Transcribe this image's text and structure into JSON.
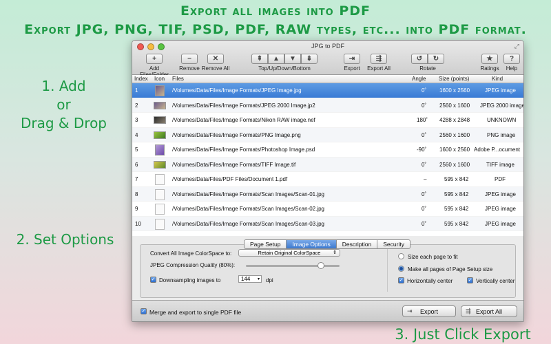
{
  "promo": {
    "headline1": "Export all images into PDF",
    "headline2": "Export JPG, PNG, TIF, PSD, PDF, RAW types, etc... into PDF format.",
    "step1_line1": "1. Add",
    "step1_line2": "or",
    "step1_line3": "Drag & Drop",
    "step2": "2. Set Options",
    "step3": "3. Just Click Export",
    "color": "#1d9a45"
  },
  "window": {
    "title": "JPG to PDF",
    "toolbar": {
      "add": "Add Files/Folder",
      "remove": "Remove",
      "remove_all": "Remove All",
      "move": "Top/Up/Down/Bottom",
      "export": "Export",
      "export_all": "Export All",
      "rotate": "Rotate",
      "ratings": "Ratings",
      "help": "Help"
    },
    "columns": {
      "index": "Index",
      "icon": "Icon",
      "files": "Files",
      "angle": "Angle",
      "size": "Size (points)",
      "kind": "Kind"
    },
    "rows": [
      {
        "index": "1",
        "file": "/Volumes/Data/Files/Image Formats/JPEG Image.jpg",
        "angle": "0˚",
        "size": "1600 x 2560",
        "kind": "JPEG image"
      },
      {
        "index": "2",
        "file": "/Volumes/Data/Files/Image Formats/JPEG 2000 Image.jp2",
        "angle": "0˚",
        "size": "2560 x 1600",
        "kind": "JPEG 2000 image"
      },
      {
        "index": "3",
        "file": "/Volumes/Data/Files/Image Formats/Nikon RAW image.nef",
        "angle": "180˚",
        "size": "4288 x 2848",
        "kind": "UNKNOWN"
      },
      {
        "index": "4",
        "file": "/Volumes/Data/Files/Image Formats/PNG Image.png",
        "angle": "0˚",
        "size": "2560 x 1600",
        "kind": "PNG image"
      },
      {
        "index": "5",
        "file": "/Volumes/Data/Files/Image Formats/Photoshop Image.psd",
        "angle": "-90˚",
        "size": "1600 x 2560",
        "kind": "Adobe P...ocument"
      },
      {
        "index": "6",
        "file": "/Volumes/Data/Files/Image Formats/TIFF Image.tif",
        "angle": "0˚",
        "size": "2560 x 1600",
        "kind": "TIFF image"
      },
      {
        "index": "7",
        "file": "/Volumes/Data/Files/PDF Files/Document 1.pdf",
        "angle": "–",
        "size": "595 x 842",
        "kind": "PDF"
      },
      {
        "index": "8",
        "file": "/Volumes/Data/Files/Image Formats/Scan Images/Scan-01.jpg",
        "angle": "0˚",
        "size": "595 x 842",
        "kind": "JPEG image"
      },
      {
        "index": "9",
        "file": "/Volumes/Data/Files/Image Formats/Scan Images/Scan-02.jpg",
        "angle": "0˚",
        "size": "595 x 842",
        "kind": "JPEG image"
      },
      {
        "index": "10",
        "file": "/Volumes/Data/Files/Image Formats/Scan Images/Scan-03.jpg",
        "angle": "0˚",
        "size": "595 x 842",
        "kind": "JPEG image"
      }
    ],
    "tabs": [
      "Page Setup",
      "Image Options",
      "Description",
      "Security"
    ],
    "active_tab": "Image Options",
    "options": {
      "colorspace_label": "Convert All Image ColorSpace to:",
      "colorspace_value": "Retain Original ColorSpace",
      "quality_label": "JPEG Compression Quality (80%):",
      "quality_value": 0.8,
      "downsample_label": "Downsampling images to",
      "downsample_value": "144",
      "downsample_unit": "dpi",
      "size_each": "Size each page to fit",
      "make_all": "Make all pages of Page Setup size",
      "h_center": "Horizontally center",
      "v_center": "Vertically center"
    },
    "footer": {
      "merge_label": "Merge and export to single PDF file",
      "export": "Export",
      "export_all": "Export All"
    },
    "accent": "#3a7bd5"
  }
}
